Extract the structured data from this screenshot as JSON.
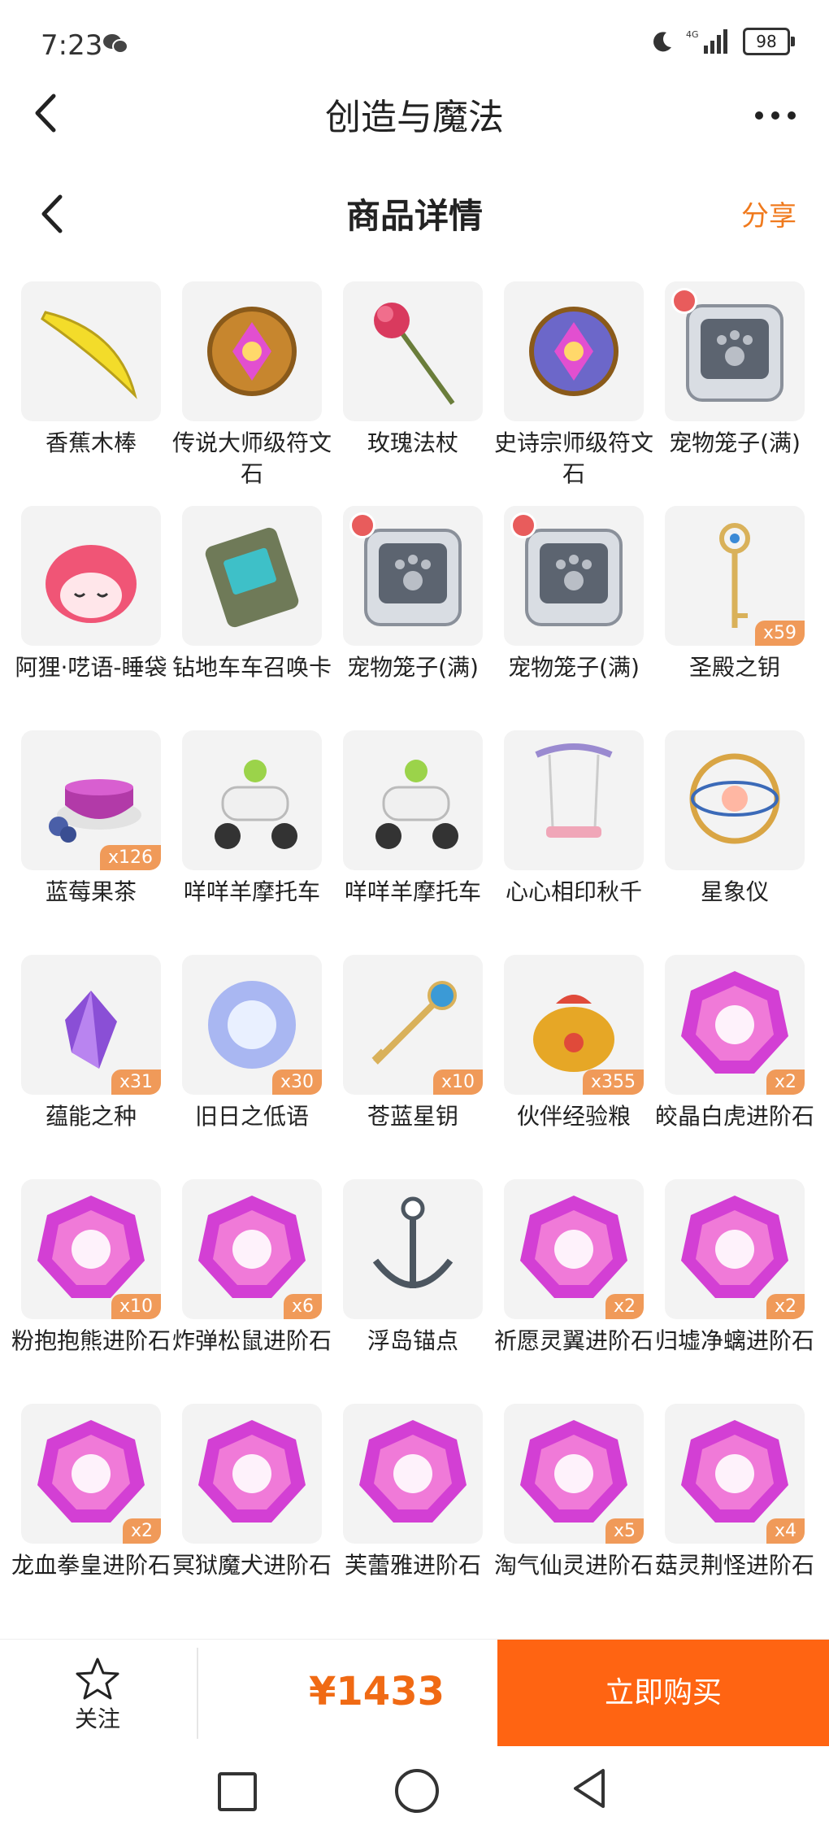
{
  "status_bar": {
    "time": "7:23",
    "battery": "98",
    "network": "4G"
  },
  "app_bar": {
    "title": "创造与魔法"
  },
  "page_bar": {
    "title": "商品详情",
    "share": "分享"
  },
  "items": [
    {
      "name": "香蕉木棒",
      "qty": "",
      "icon": "banana-icon",
      "color": "#f3dc2a"
    },
    {
      "name": "传说大师级符文石",
      "qty": "",
      "icon": "rune-stone-icon",
      "color": "#c7862e"
    },
    {
      "name": "玫瑰法杖",
      "qty": "",
      "icon": "rose-staff-icon",
      "color": "#d93a5e"
    },
    {
      "name": "史诗宗师级符文石",
      "qty": "",
      "icon": "rune-stone-icon",
      "color": "#6c67c9"
    },
    {
      "name": "宠物笼子(满)",
      "qty": "",
      "icon": "pet-cage-icon",
      "color": "#5c6470"
    },
    {
      "name": "阿狸·呓语-睡袋",
      "qty": "",
      "icon": "sleeping-bag-icon",
      "color": "#f05576"
    },
    {
      "name": "钻地车车召唤卡",
      "qty": "",
      "icon": "summon-card-icon",
      "color": "#6f7a58"
    },
    {
      "name": "宠物笼子(满)",
      "qty": "",
      "icon": "pet-cage-icon",
      "color": "#5c6470"
    },
    {
      "name": "宠物笼子(满)",
      "qty": "",
      "icon": "pet-cage-icon",
      "color": "#5c6470"
    },
    {
      "name": "圣殿之钥",
      "qty": "x59",
      "icon": "key-icon",
      "color": "#d9b15a"
    },
    {
      "name": "蓝莓果茶",
      "qty": "x126",
      "icon": "tea-cup-icon",
      "color": "#b23aa8"
    },
    {
      "name": "咩咩羊摩托车",
      "qty": "",
      "icon": "scooter-icon",
      "color": "#f0f0f0"
    },
    {
      "name": "咩咩羊摩托车",
      "qty": "",
      "icon": "scooter-icon",
      "color": "#f0f0f0"
    },
    {
      "name": "心心相印秋千",
      "qty": "",
      "icon": "swing-icon",
      "color": "#9a8ad0"
    },
    {
      "name": "星象仪",
      "qty": "",
      "icon": "astrolabe-icon",
      "color": "#d9a544"
    },
    {
      "name": "蕴能之种",
      "qty": "x31",
      "icon": "crystal-icon",
      "color": "#8a4fd6"
    },
    {
      "name": "旧日之低语",
      "qty": "x30",
      "icon": "orb-icon",
      "color": "#a9b7f2"
    },
    {
      "name": "苍蓝星钥",
      "qty": "x10",
      "icon": "blue-key-icon",
      "color": "#3b9ad6"
    },
    {
      "name": "伙伴经验粮",
      "qty": "x355",
      "icon": "food-bag-icon",
      "color": "#e6a726"
    },
    {
      "name": "皎晶白虎进阶石",
      "qty": "x2",
      "icon": "advance-stone-icon",
      "color": "#d33fd4"
    },
    {
      "name": "粉抱抱熊进阶石",
      "qty": "x10",
      "icon": "advance-stone-icon",
      "color": "#d33fd4"
    },
    {
      "name": "炸弹松鼠进阶石",
      "qty": "x6",
      "icon": "advance-stone-icon",
      "color": "#d33fd4"
    },
    {
      "name": "浮岛锚点",
      "qty": "",
      "icon": "anchor-icon",
      "color": "#4c5660"
    },
    {
      "name": "祈愿灵翼进阶石",
      "qty": "x2",
      "icon": "advance-stone-icon",
      "color": "#d33fd4"
    },
    {
      "name": "归墟净螭进阶石",
      "qty": "x2",
      "icon": "advance-stone-icon",
      "color": "#d33fd4"
    },
    {
      "name": "龙血拳皇进阶石",
      "qty": "x2",
      "icon": "advance-stone-icon",
      "color": "#d33fd4"
    },
    {
      "name": "冥狱魔犬进阶石",
      "qty": "",
      "icon": "advance-stone-icon",
      "color": "#d33fd4"
    },
    {
      "name": "芙蕾雅进阶石",
      "qty": "",
      "icon": "advance-stone-icon",
      "color": "#d33fd4"
    },
    {
      "name": "淘气仙灵进阶石",
      "qty": "x5",
      "icon": "advance-stone-icon",
      "color": "#d33fd4"
    },
    {
      "name": "菇灵荆怪进阶石",
      "qty": "x4",
      "icon": "advance-stone-icon",
      "color": "#d33fd4"
    }
  ],
  "action_bar": {
    "follow": "关注",
    "price": "¥1433",
    "buy": "立即购买"
  },
  "colors": {
    "accent": "#ff6412",
    "price": "#f06a14",
    "share": "#f07a1d"
  }
}
